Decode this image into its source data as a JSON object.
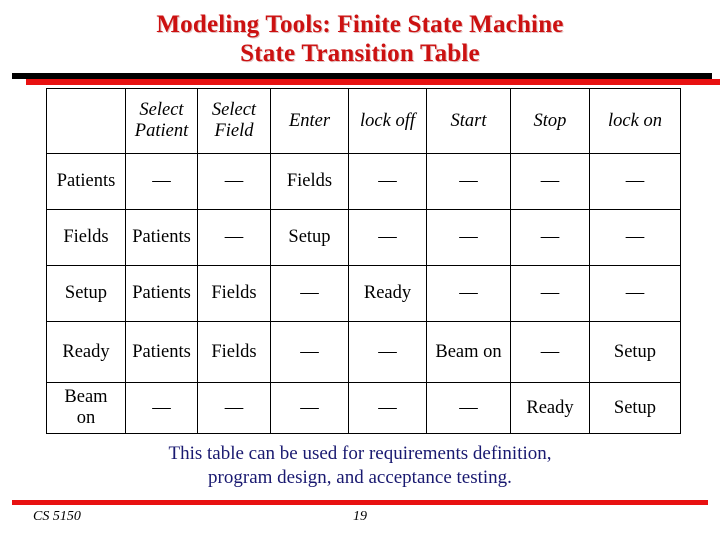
{
  "slide": {
    "title_line1": "Modeling Tools: Finite State Machine",
    "title_line2": "State Transition Table",
    "title_color": "#cc1111",
    "caption_line1": "This table can be used for requirements definition,",
    "caption_line2": "program design, and acceptance testing.",
    "caption_color": "#191970"
  },
  "table": {
    "stub_header": "",
    "column_headers": [
      "Select Patient",
      "Select Field",
      "Enter",
      "lock off",
      "Start",
      "Stop",
      "lock on"
    ],
    "column_headers_wrapped": [
      {
        "l1": "Select",
        "l2": "Patient"
      },
      {
        "l1": "Select",
        "l2": "Field"
      },
      {
        "l1": "Enter",
        "l2": ""
      },
      {
        "l1": "lock off",
        "l2": ""
      },
      {
        "l1": "Start",
        "l2": ""
      },
      {
        "l1": "Stop",
        "l2": ""
      },
      {
        "l1": "lock on",
        "l2": ""
      }
    ],
    "dash": "—",
    "rows": [
      {
        "state": "Patients",
        "state_l1": "Patients",
        "state_l2": "",
        "cells": [
          "—",
          "—",
          "Fields",
          "—",
          "—",
          "—",
          "—"
        ]
      },
      {
        "state": "Fields",
        "state_l1": "Fields",
        "state_l2": "",
        "cells": [
          "Patients",
          "—",
          "Setup",
          "—",
          "—",
          "—",
          "—"
        ]
      },
      {
        "state": "Setup",
        "state_l1": "Setup",
        "state_l2": "",
        "cells": [
          "Patients",
          "Fields",
          "—",
          "Ready",
          "—",
          "—",
          "—"
        ]
      },
      {
        "state": "Ready",
        "state_l1": "Ready",
        "state_l2": "",
        "cells": [
          "Patients",
          "Fields",
          "—",
          "—",
          "Beam on",
          "—",
          "Setup"
        ]
      },
      {
        "state": "Beam on",
        "state_l1": "Beam",
        "state_l2": "on",
        "cells": [
          "—",
          "—",
          "—",
          "—",
          "—",
          "Ready",
          "Setup"
        ]
      }
    ]
  },
  "footer": {
    "course": "CS 5150",
    "page_number": "19",
    "rule_color": "#e81111"
  },
  "rules": {
    "black_bar_color": "#000000",
    "red_bar_color": "#e81111"
  }
}
